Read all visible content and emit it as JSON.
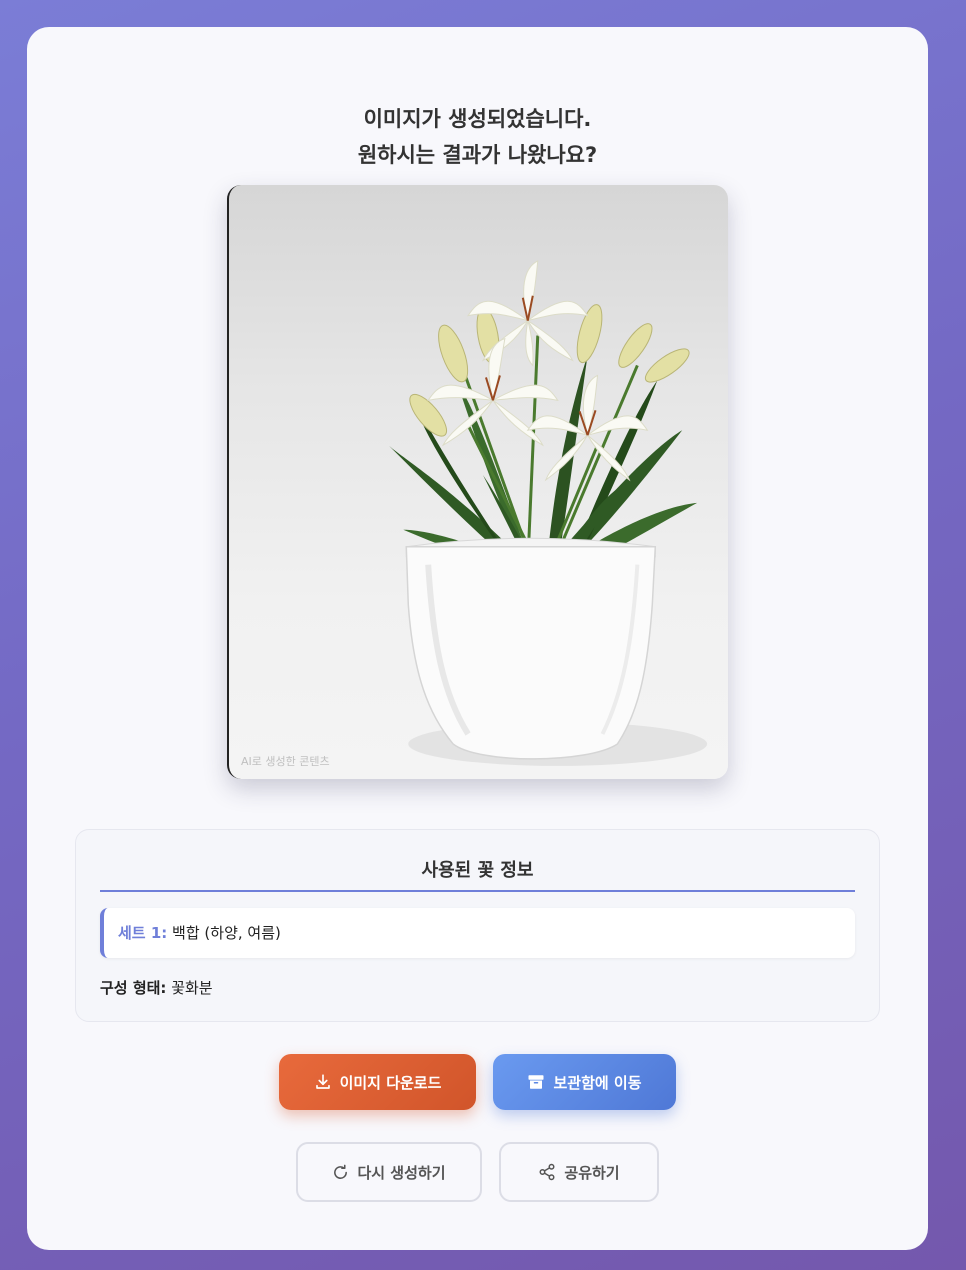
{
  "headline": {
    "line1": "이미지가 생성되었습니다.",
    "line2": "원하시는 결과가 나왔나요?"
  },
  "image": {
    "subject": "white lily plant in white square pot",
    "watermark": "AI로 생성한 콘텐츠"
  },
  "info": {
    "title": "사용된 꽃 정보",
    "set_label": "세트 1:",
    "set_value": "백합 (하양, 여름)",
    "form_label": "구성 형태:",
    "form_value": "꽃화분"
  },
  "buttons": {
    "download": "이미지 다운로드",
    "storage": "보관함에 이동",
    "regenerate": "다시 생성하기",
    "share": "공유하기"
  },
  "colors": {
    "accent": "#6f7fd9",
    "download_bg": "#e0623a",
    "storage_bg": "#5a86e3"
  }
}
